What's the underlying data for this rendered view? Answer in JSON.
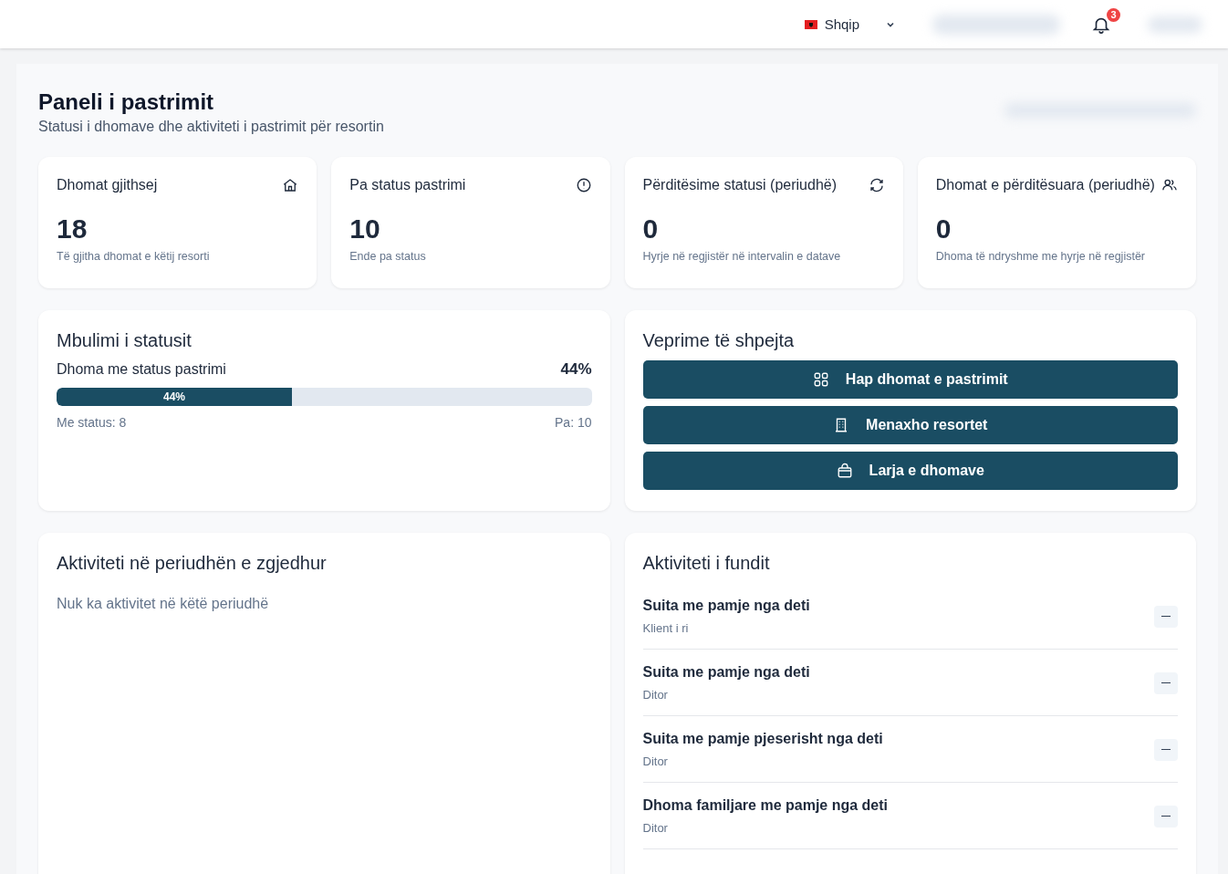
{
  "header": {
    "language": {
      "label": "Shqip"
    },
    "notifications": {
      "count": "3"
    }
  },
  "page": {
    "title": "Paneli i pastrimit",
    "subtitle": "Statusi i dhomave dhe aktiviteti i pastrimit për resortin"
  },
  "stats": [
    {
      "label": "Dhomat gjithsej",
      "value": "18",
      "note": "Të gjitha dhomat e këtij resorti"
    },
    {
      "label": "Pa status pastrimi",
      "value": "10",
      "note": "Ende pa status"
    },
    {
      "label": "Përditësime statusi (periudhë)",
      "value": "0",
      "note": "Hyrje në regjistër në intervalin e datave"
    },
    {
      "label": "Dhomat e përditësuara (periudhë)",
      "value": "0",
      "note": "Dhoma të ndryshme me hyrje në regjistër"
    }
  ],
  "coverage": {
    "title": "Mbulimi i statusit",
    "label": "Dhoma me status pastrimi",
    "percent": "44%",
    "bar_label": "44%",
    "level": 0.44,
    "with_status": "Me status: 8",
    "without_status": "Pa: 10"
  },
  "quick_actions": {
    "title": "Veprime të shpejta",
    "buttons": [
      {
        "label": "Hap dhomat e pastrimit"
      },
      {
        "label": "Menaxho resortet"
      },
      {
        "label": "Larja e dhomave"
      }
    ]
  },
  "period_activity": {
    "title": "Aktiviteti në periudhën e zgjedhur",
    "empty": "Nuk ka aktivitet në këtë periudhë"
  },
  "recent_activity": {
    "title": "Aktiviteti i fundit",
    "items": [
      {
        "name": "Suita me pamje nga deti",
        "detail": "Klient i ri"
      },
      {
        "name": "Suita me pamje nga deti",
        "detail": "Ditor"
      },
      {
        "name": "Suita me pamje pjeserisht nga deti",
        "detail": "Ditor"
      },
      {
        "name": "Dhoma familjare me pamje nga deti",
        "detail": "Ditor"
      }
    ]
  }
}
